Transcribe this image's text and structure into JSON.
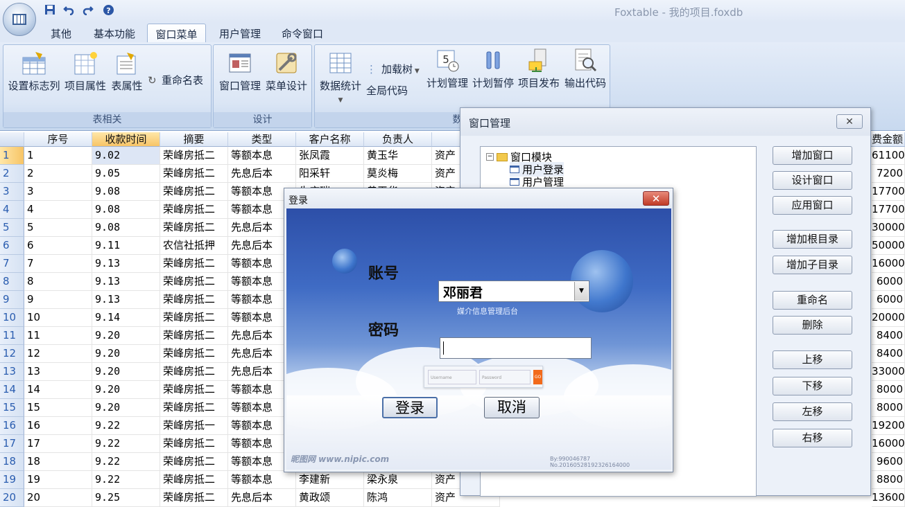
{
  "app": {
    "title": "Foxtable - 我的项目.foxdb"
  },
  "tabs": [
    "其他",
    "基本功能",
    "窗口菜单",
    "用户管理",
    "命令窗口"
  ],
  "ribbon": {
    "groups": [
      {
        "label": "表相关",
        "buttons": [
          "设置标志列",
          "项目属性",
          "表属性",
          "重命名表"
        ]
      },
      {
        "label": "设计",
        "buttons": [
          "窗口管理",
          "菜单设计"
        ]
      },
      {
        "label": "数据",
        "buttons": [
          "数据统计",
          "加载树",
          "全局代码",
          "计划管理",
          "计划暂停",
          "项目发布",
          "输出代码"
        ]
      }
    ]
  },
  "grid": {
    "headers": [
      "序号",
      "收款时间",
      "摘要",
      "类型",
      "客户名称",
      "负责人",
      "部",
      "费金额"
    ],
    "rows": [
      {
        "n": "1",
        "seq": "1",
        "time": "9.02",
        "summary": "荣峰房抵二",
        "type": "等额本息",
        "client": "张凤霞",
        "owner": "黄玉华",
        "dept": "资产",
        "amt": "61100"
      },
      {
        "n": "2",
        "seq": "2",
        "time": "9.05",
        "summary": "荣峰房抵二",
        "type": "先息后本",
        "client": "阳采轩",
        "owner": "莫炎梅",
        "dept": "资产",
        "amt": "7200"
      },
      {
        "n": "3",
        "seq": "3",
        "time": "9.08",
        "summary": "荣峰房抵二",
        "type": "等额本息",
        "client": "朱庆瑞",
        "owner": "黄玉华",
        "dept": "资产",
        "amt": "17700"
      },
      {
        "n": "4",
        "seq": "4",
        "time": "9.08",
        "summary": "荣峰房抵二",
        "type": "等额本息",
        "client": "",
        "owner": "",
        "dept": "",
        "amt": "17700"
      },
      {
        "n": "5",
        "seq": "5",
        "time": "9.08",
        "summary": "荣峰房抵二",
        "type": "先息后本",
        "client": "",
        "owner": "",
        "dept": "",
        "amt": "30000"
      },
      {
        "n": "6",
        "seq": "6",
        "time": "9.11",
        "summary": "农信社抵押",
        "type": "先息后本",
        "client": "",
        "owner": "",
        "dept": "",
        "amt": "50000"
      },
      {
        "n": "7",
        "seq": "7",
        "time": "9.13",
        "summary": "荣峰房抵二",
        "type": "等额本息",
        "client": "",
        "owner": "",
        "dept": "",
        "amt": "16000"
      },
      {
        "n": "8",
        "seq": "8",
        "time": "9.13",
        "summary": "荣峰房抵二",
        "type": "等额本息",
        "client": "",
        "owner": "",
        "dept": "",
        "amt": "6000"
      },
      {
        "n": "9",
        "seq": "9",
        "time": "9.13",
        "summary": "荣峰房抵二",
        "type": "等额本息",
        "client": "",
        "owner": "",
        "dept": "",
        "amt": "6000"
      },
      {
        "n": "10",
        "seq": "10",
        "time": "9.14",
        "summary": "荣峰房抵二",
        "type": "等额本息",
        "client": "",
        "owner": "",
        "dept": "",
        "amt": "20000"
      },
      {
        "n": "11",
        "seq": "11",
        "time": "9.20",
        "summary": "荣峰房抵二",
        "type": "先息后本",
        "client": "",
        "owner": "",
        "dept": "",
        "amt": "8400"
      },
      {
        "n": "12",
        "seq": "12",
        "time": "9.20",
        "summary": "荣峰房抵二",
        "type": "先息后本",
        "client": "",
        "owner": "",
        "dept": "",
        "amt": "8400"
      },
      {
        "n": "13",
        "seq": "13",
        "time": "9.20",
        "summary": "荣峰房抵二",
        "type": "先息后本",
        "client": "",
        "owner": "",
        "dept": "",
        "amt": "33000"
      },
      {
        "n": "14",
        "seq": "14",
        "time": "9.20",
        "summary": "荣峰房抵二",
        "type": "等额本息",
        "client": "",
        "owner": "",
        "dept": "",
        "amt": "8000"
      },
      {
        "n": "15",
        "seq": "15",
        "time": "9.20",
        "summary": "荣峰房抵二",
        "type": "等额本息",
        "client": "",
        "owner": "",
        "dept": "",
        "amt": "8000"
      },
      {
        "n": "16",
        "seq": "16",
        "time": "9.22",
        "summary": "荣峰房抵一",
        "type": "等额本息",
        "client": "",
        "owner": "",
        "dept": "",
        "amt": "19200"
      },
      {
        "n": "17",
        "seq": "17",
        "time": "9.22",
        "summary": "荣峰房抵二",
        "type": "等额本息",
        "client": "",
        "owner": "",
        "dept": "",
        "amt": "16000"
      },
      {
        "n": "18",
        "seq": "18",
        "time": "9.22",
        "summary": "荣峰房抵二",
        "type": "等额本息",
        "client": "",
        "owner": "",
        "dept": "",
        "amt": "9600"
      },
      {
        "n": "19",
        "seq": "19",
        "time": "9.22",
        "summary": "荣峰房抵二",
        "type": "等额本息",
        "client": "李建新",
        "owner": "梁永泉",
        "dept": "资产",
        "amt": "8800"
      },
      {
        "n": "20",
        "seq": "20",
        "time": "9.25",
        "summary": "荣峰房抵二",
        "type": "先息后本",
        "client": "黄政颂",
        "owner": "陈鸿",
        "dept": "资产",
        "amt": "13600"
      }
    ]
  },
  "window_mgr": {
    "title": "窗口管理",
    "tree": {
      "root": "窗口模块",
      "children": [
        "用户登录",
        "用户管理"
      ]
    },
    "buttons": [
      "增加窗口",
      "设计窗口",
      "应用窗口",
      "增加根目录",
      "增加子目录",
      "重命名",
      "删除",
      "上移",
      "下移",
      "左移",
      "右移"
    ]
  },
  "login": {
    "title": "登录",
    "account_label": "账号",
    "account_value": "邓丽君",
    "password_label": "密码",
    "subtitle": "媒介信息管理后台",
    "mini_username": "Username",
    "mini_password": "Password",
    "mini_go": "GO",
    "login_button": "登录",
    "cancel_button": "取消",
    "watermark": "昵图网 www.nipic.com",
    "footer": "By:990046787 No.20160528192326164000"
  }
}
